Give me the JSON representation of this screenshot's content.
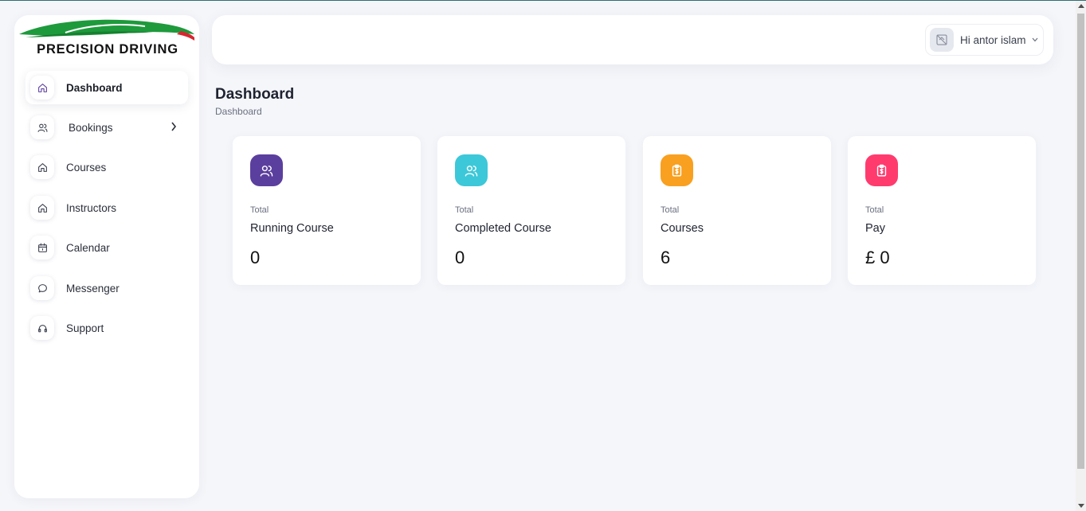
{
  "brand": {
    "logo_text": "PRECISION DRIVING",
    "colors": {
      "green": "#1e9a3c",
      "red": "#d8262f"
    }
  },
  "sidebar": {
    "items": [
      {
        "label": "Dashboard",
        "icon": "home-icon",
        "active": true
      },
      {
        "label": "Bookings",
        "icon": "users-icon",
        "has_submenu": true
      },
      {
        "label": "Courses",
        "icon": "home-icon"
      },
      {
        "label": "Instructors",
        "icon": "home-icon"
      },
      {
        "label": "Calendar",
        "icon": "calendar-icon"
      },
      {
        "label": "Messenger",
        "icon": "message-icon"
      },
      {
        "label": "Support",
        "icon": "headphones-icon"
      }
    ]
  },
  "header": {
    "user_greeting": "Hi antor islam",
    "avatar_icon": "avatar-icon",
    "chevron_icon": "chevron-down-icon"
  },
  "page": {
    "title": "Dashboard",
    "breadcrumb": "Dashboard"
  },
  "cards": [
    {
      "small": "Total",
      "label": "Running Course",
      "value": "0",
      "icon": "users-icon",
      "color": "#5b3f9e"
    },
    {
      "small": "Total",
      "label": "Completed Course",
      "value": "0",
      "icon": "users-icon",
      "color": "#3cc8d8"
    },
    {
      "small": "Total",
      "label": "Courses",
      "value": "6",
      "icon": "clipboard-dollar-icon",
      "color": "#f9a020"
    },
    {
      "small": "Total",
      "label": "Pay",
      "value": "£ 0",
      "icon": "clipboard-dollar-icon",
      "color": "#ff3b6e"
    }
  ]
}
